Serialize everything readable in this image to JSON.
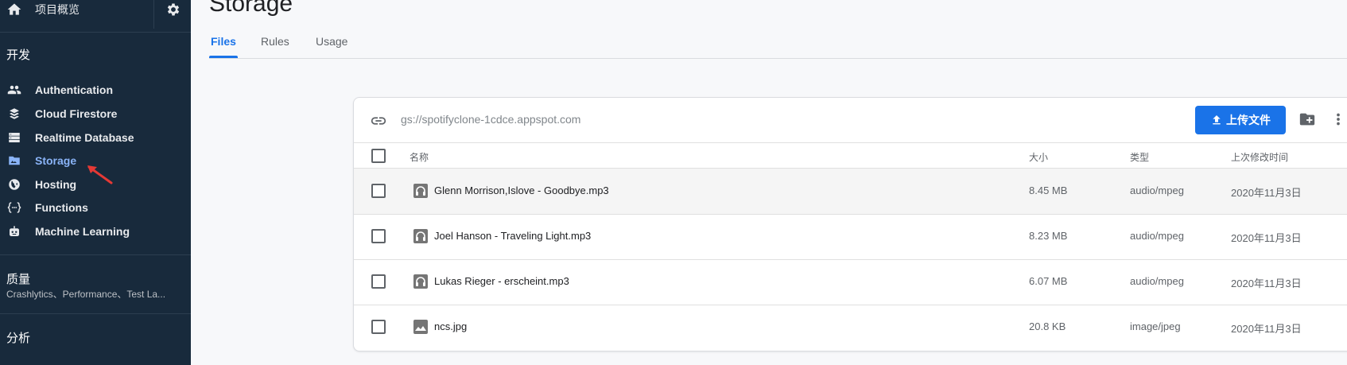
{
  "sidebar": {
    "overview_label": "项目概览",
    "section_dev": "开发",
    "items": [
      {
        "label": "Authentication",
        "icon": "people-icon"
      },
      {
        "label": "Cloud Firestore",
        "icon": "firestore-icon"
      },
      {
        "label": "Realtime Database",
        "icon": "database-icon"
      },
      {
        "label": "Storage",
        "icon": "storage-icon"
      },
      {
        "label": "Hosting",
        "icon": "globe-icon"
      },
      {
        "label": "Functions",
        "icon": "functions-icon"
      },
      {
        "label": "Machine Learning",
        "icon": "robot-icon"
      }
    ],
    "active_item": "Storage",
    "section_quality": "质量",
    "quality_sub": "Crashlytics、Performance、Test La...",
    "section_analytics": "分析"
  },
  "page": {
    "title": "Storage",
    "tabs": [
      "Files",
      "Rules",
      "Usage"
    ],
    "active_tab": "Files"
  },
  "storage": {
    "bucket_url": "gs://spotifyclone-1cdce.appspot.com",
    "upload_label": "上传文件",
    "columns": {
      "name": "名称",
      "size": "大小",
      "type": "类型",
      "modified": "上次修改时间"
    },
    "files": [
      {
        "name": "Glenn Morrison,Islove - Goodbye.mp3",
        "size": "8.45 MB",
        "type": "audio/mpeg",
        "modified": "2020年11月3日",
        "icon": "audio-file-icon"
      },
      {
        "name": "Joel Hanson - Traveling Light.mp3",
        "size": "8.23 MB",
        "type": "audio/mpeg",
        "modified": "2020年11月3日",
        "icon": "audio-file-icon"
      },
      {
        "name": "Lukas Rieger - erscheint.mp3",
        "size": "6.07 MB",
        "type": "audio/mpeg",
        "modified": "2020年11月3日",
        "icon": "audio-file-icon"
      },
      {
        "name": "ncs.jpg",
        "size": "20.8 KB",
        "type": "image/jpeg",
        "modified": "2020年11月3日",
        "icon": "image-file-icon"
      }
    ]
  },
  "colors": {
    "sidebar_bg": "#182a3c",
    "accent": "#1a73e8",
    "active_nav": "#8ab4f8",
    "annotation_arrow": "#e53935"
  }
}
